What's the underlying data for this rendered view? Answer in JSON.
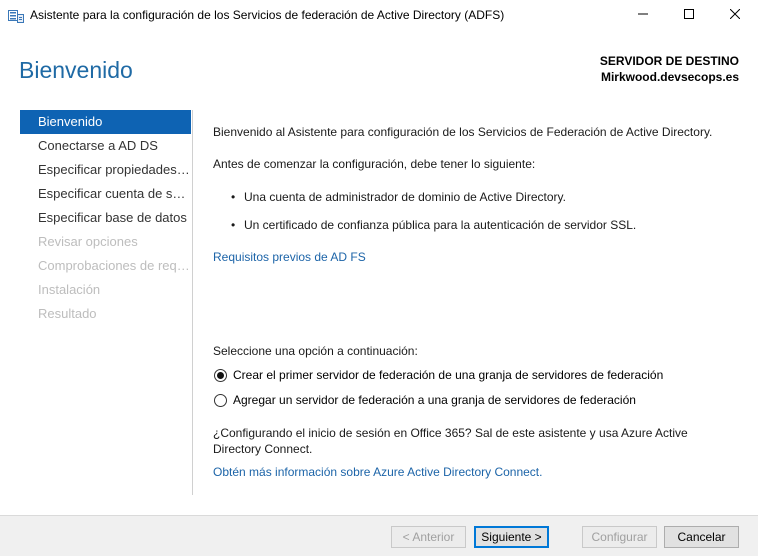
{
  "window": {
    "title": "Asistente para la configuración de los Servicios de federación de Active Directory (ADFS)",
    "icon": "server-wizard-icon",
    "controls": [
      "minimize-icon",
      "maximize-icon",
      "close-icon"
    ]
  },
  "header": {
    "page_title": "Bienvenido",
    "server_label": "SERVIDOR DE DESTINO",
    "server_name": "Mirkwood.devsecops.es"
  },
  "nav": {
    "items": [
      {
        "label": "Bienvenido",
        "state": "active"
      },
      {
        "label": "Conectarse a AD DS",
        "state": "enabled"
      },
      {
        "label": "Especificar propiedades d...",
        "state": "enabled"
      },
      {
        "label": "Especificar cuenta de serv...",
        "state": "enabled"
      },
      {
        "label": "Especificar base de datos",
        "state": "enabled"
      },
      {
        "label": "Revisar opciones",
        "state": "disabled"
      },
      {
        "label": "Comprobaciones de requ...",
        "state": "disabled"
      },
      {
        "label": "Instalación",
        "state": "disabled"
      },
      {
        "label": "Resultado",
        "state": "disabled"
      }
    ]
  },
  "main": {
    "intro": "Bienvenido al Asistente para configuración de los Servicios de Federación de Active Directory.",
    "prereq_heading": "Antes de comenzar la configuración, debe tener lo siguiente:",
    "bullets": [
      "Una cuenta de administrador de dominio de Active Directory.",
      "Un certificado de confianza pública para la autenticación de servidor SSL."
    ],
    "prereq_link": "Requisitos previos de AD FS",
    "option_prompt": "Seleccione una opción a continuación:",
    "options": [
      {
        "label": "Crear el primer servidor de federación de una granja de servidores de federación",
        "checked": true
      },
      {
        "label": "Agregar un servidor de federación a una granja de servidores de federación",
        "checked": false
      }
    ],
    "office_note": "¿Configurando el inicio de sesión en Office 365? Sal de este asistente y usa Azure Active Directory Connect.",
    "azure_link": "Obtén más información sobre Azure Active Directory Connect."
  },
  "footer": {
    "prev_label": "< Anterior",
    "next_label": "Siguiente >",
    "configure_label": "Configurar",
    "cancel_label": "Cancelar"
  },
  "colors": {
    "accent": "#0e63b3",
    "title": "#1f6aa5",
    "link": "#1c64a8"
  }
}
